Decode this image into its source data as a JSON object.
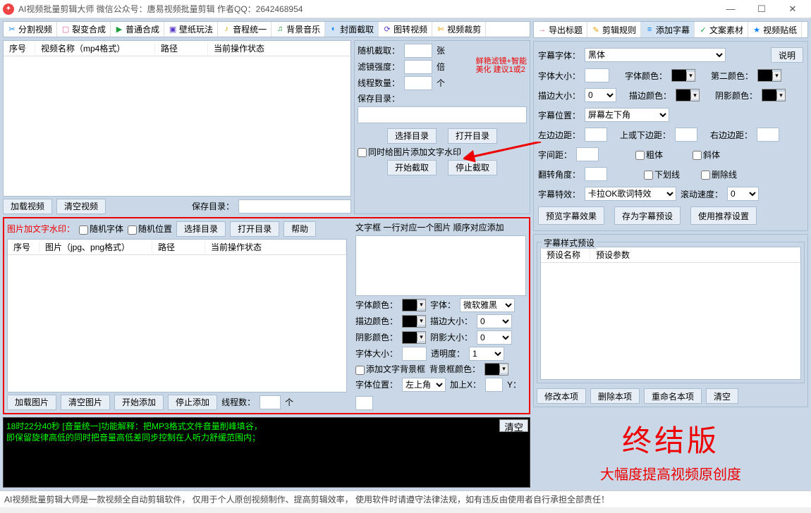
{
  "title": "AI视频批量剪辑大师   微信公众号：唐易视频批量剪辑    作者QQ：2642468954",
  "win": {
    "min": "—",
    "max": "☐",
    "close": "✕"
  },
  "leftTabs": [
    {
      "icon": "✂",
      "color": "#0a84ff",
      "label": "分割视频"
    },
    {
      "icon": "▢",
      "color": "#e05a9c",
      "label": "裂变合成"
    },
    {
      "icon": "▶",
      "color": "#1a9e3c",
      "label": "普通合成"
    },
    {
      "icon": "▣",
      "color": "#5a3cc8",
      "label": "壁纸玩法"
    },
    {
      "icon": "♪",
      "color": "#e0a000",
      "label": "音程统一"
    },
    {
      "icon": "♫",
      "color": "#1a9e3c",
      "label": "背景音乐"
    },
    {
      "icon": "◐",
      "color": "#0a84ff",
      "label": "封面截取",
      "active": true
    },
    {
      "icon": "⟳",
      "color": "#5a3cc8",
      "label": "图转视频"
    },
    {
      "icon": "✄",
      "color": "#e0a000",
      "label": "视频裁剪"
    }
  ],
  "rightTabs": [
    {
      "icon": "→",
      "color": "#e05a9c",
      "label": "导出标题"
    },
    {
      "icon": "✎",
      "color": "#e0a000",
      "label": "剪辑规则"
    },
    {
      "icon": "≡",
      "color": "#0a84ff",
      "label": "添加字幕",
      "active": true
    },
    {
      "icon": "✓",
      "color": "#1a9e3c",
      "label": "文案素材"
    },
    {
      "icon": "★",
      "color": "#0a84ff",
      "label": "视频贴纸"
    }
  ],
  "videoTable": {
    "h1": "序号",
    "h2": "视频名称（mp4格式）",
    "h3": "路径",
    "h4": "当前操作状态"
  },
  "btns": {
    "loadVideo": "加载视频",
    "clearVideo": "清空视频",
    "saveDirLbl": "保存目录：",
    "selectDir": "选择目录",
    "openDir": "打开目录",
    "help": "帮助",
    "startCap": "开始截取",
    "stopCap": "停止截取",
    "loadImg": "加载图片",
    "clearImg": "清空图片",
    "startAdd": "开始添加",
    "stopAdd": "停止添加",
    "preview": "预览字幕效果",
    "savePreset": "存为字幕预设",
    "useRec": "使用推荐设置",
    "modItem": "修改本项",
    "delItem": "删除本项",
    "rename": "重命名本项",
    "clear": "清空",
    "explain": "说明",
    "clearLog": "清空"
  },
  "cap": {
    "randLbl": "随机截取：",
    "randUnit": "张",
    "filterLbl": "滤镜强度：",
    "filterUnit": "倍",
    "threadLbl": "线程数量：",
    "threadUnit": "个",
    "saveLbl": "保存目录：",
    "hint1": "鲜艳滤镜+智能",
    "hint2": "美化 建议1或2",
    "chkWm": "同时给图片添加文字水印"
  },
  "wm": {
    "title": "图片加文字水印：",
    "chkFont": "随机字体",
    "chkPos": "随机位置",
    "h1": "序号",
    "h2": "图片（jpg、png格式）",
    "h3": "路径",
    "h4": "当前操作状态",
    "threadLbl": "线程数：",
    "threadUnit": "个",
    "textboxLbl": "文字框 一行对应一个图片 顺序对应添加",
    "fontColorLbl": "字体颜色：",
    "fontLbl": "字体：",
    "fontVal": "微软雅黑",
    "strokeColorLbl": "描边颜色：",
    "strokeSizeLbl": "描边大小：",
    "strokeVal": "0",
    "shadowColorLbl": "阴影颜色：",
    "shadowSizeLbl": "阴影大小：",
    "shadowVal": "0",
    "fontSizeLbl": "字体大小：",
    "opacityLbl": "透明度：",
    "opacityVal": "1",
    "chkBg": "添加文字背景框",
    "bgColorLbl": "背景框颜色：",
    "posLbl": "字体位置：",
    "posVal": "左上角",
    "addXLbl": "加上X：",
    "yLbl": "Y："
  },
  "sub": {
    "fontLbl": "字幕字体：",
    "fontVal": "黑体",
    "sizeLbl": "字体大小：",
    "fontColorLbl": "字体颜色：",
    "color2Lbl": "第二颜色：",
    "strokeSizeLbl": "描边大小：",
    "strokeVal": "0",
    "strokeColorLbl": "描边颜色：",
    "shadowColorLbl": "阴影颜色：",
    "posLbl": "字幕位置：",
    "posVal": "屏幕左下角",
    "leftLbl": "左边边距：",
    "topLbl": "上或下边距：",
    "rightLbl": "右边边距：",
    "spacingLbl": "字间距：",
    "chkBold": "粗体",
    "chkItalic": "斜体",
    "rotateLbl": "翻转角度：",
    "chkUnder": "下划线",
    "chkStrike": "删除线",
    "fxLbl": "字幕特效：",
    "fxVal": "卡拉OK歌词特效",
    "speedLbl": "滚动速度：",
    "speedVal": "0",
    "presetTitle": "字幕样式预设",
    "ph1": "预设名称",
    "ph2": "预设参数"
  },
  "log": {
    "l1": "18时22分40秒 [音量统一]功能解释：把MP3格式文件音量削峰填谷，",
    "l2": "        即保留旋律高低的同时把音量高低差同步控制在人听力舒缓范围内；"
  },
  "brand": {
    "l1": "终结版",
    "l2": "大幅度提高视频原创度"
  },
  "footer": "AI视频批量剪辑大师是一款视频全自动剪辑软件，   仅用于个人原创视频制作、提高剪辑效率，  使用软件时请遵守法律法规，如有违反由使用者自行承担全部责任！"
}
